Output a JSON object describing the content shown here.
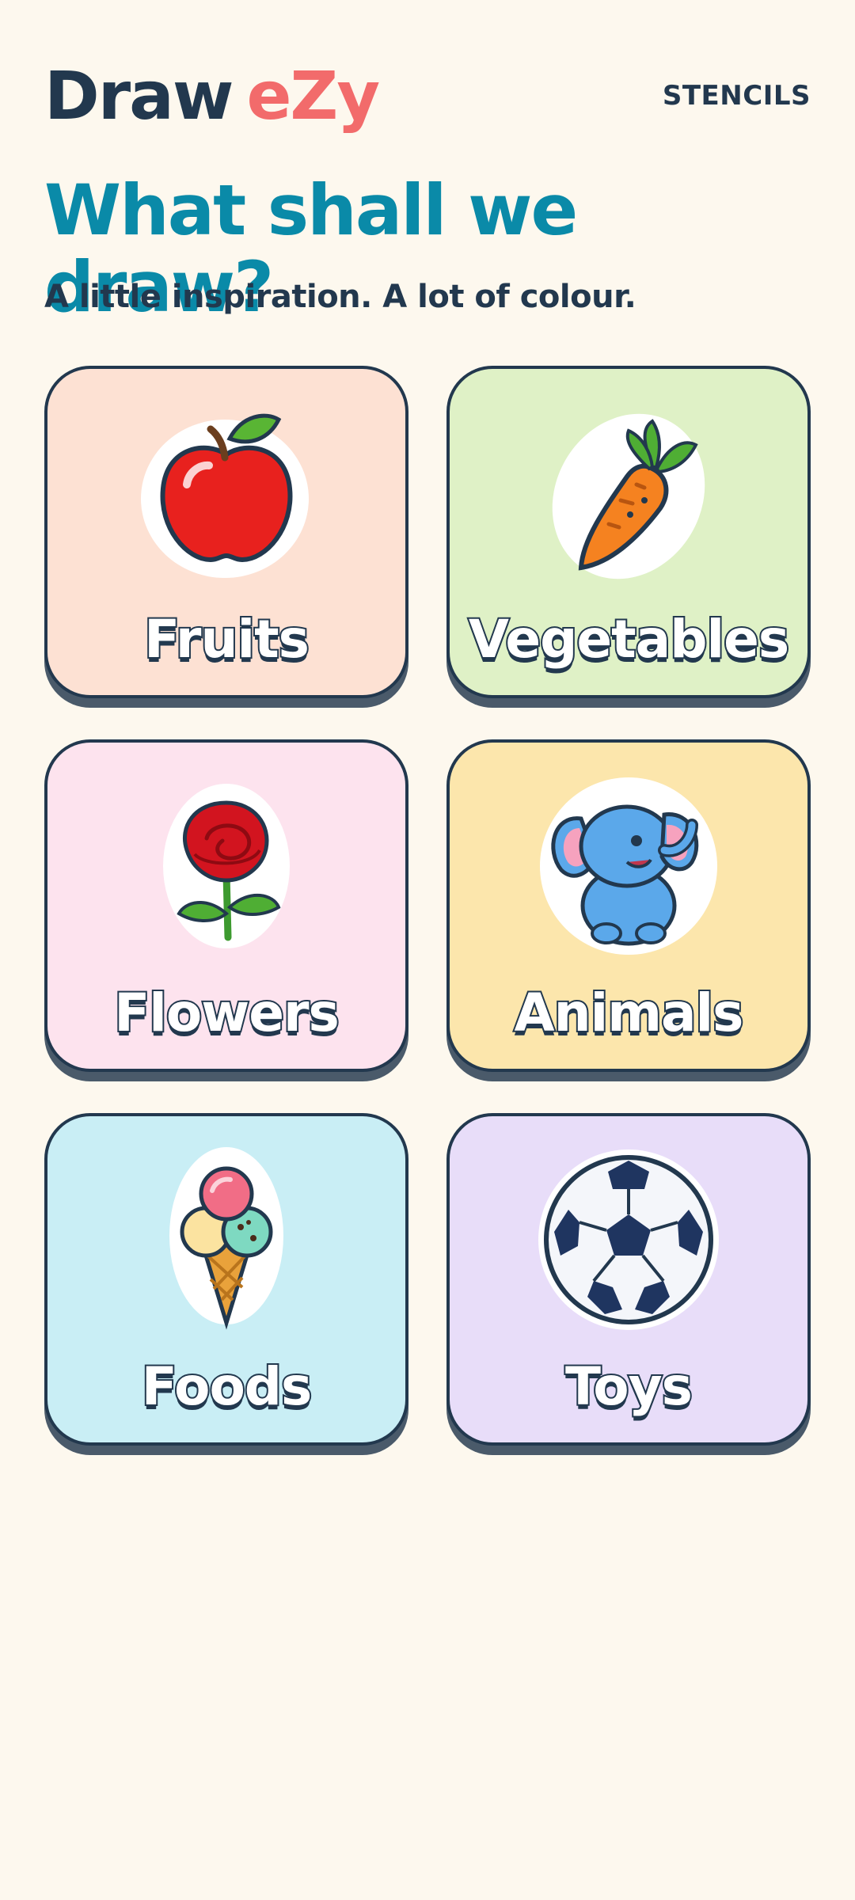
{
  "header": {
    "logo_part1": "Draw",
    "logo_part2": "eZy",
    "nav_stencils": "STENCILS"
  },
  "main": {
    "title": "What shall we draw?",
    "subtitle": "A little inspiration. A lot of colour."
  },
  "categories": [
    {
      "label": "Fruits",
      "icon": "apple-icon",
      "color": "#FDE1D3"
    },
    {
      "label": "Vegetables",
      "icon": "carrot-icon",
      "color": "#DFF1C6"
    },
    {
      "label": "Flowers",
      "icon": "rose-icon",
      "color": "#FDE3EE"
    },
    {
      "label": "Animals",
      "icon": "elephant-icon",
      "color": "#FCE6AC"
    },
    {
      "label": "Foods",
      "icon": "ice-cream-icon",
      "color": "#C9EEF5"
    },
    {
      "label": "Toys",
      "icon": "soccer-ball-icon",
      "color": "#E8DDF9"
    }
  ],
  "colors": {
    "background": "#FDF8EE",
    "title": "#0A8AA8",
    "ink": "#22384E",
    "logo_accent": "#F26B6B"
  }
}
